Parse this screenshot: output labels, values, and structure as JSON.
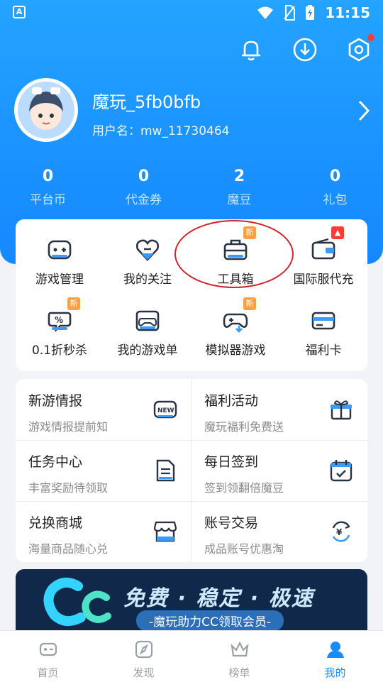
{
  "status": {
    "time": "11:15",
    "left_icon": "A"
  },
  "top_icons": [
    "bell-icon",
    "download-icon",
    "settings-icon"
  ],
  "profile": {
    "name": "魔玩_5fb0bfb",
    "user_label": "用户名：mw_11730464"
  },
  "stats": [
    {
      "value": "0",
      "label": "平台币"
    },
    {
      "value": "0",
      "label": "代金券"
    },
    {
      "value": "2",
      "label": "魔豆"
    },
    {
      "value": "0",
      "label": "礼包"
    }
  ],
  "grid": [
    {
      "label": "游戏管理",
      "icon": "gamepad-icon",
      "badge": ""
    },
    {
      "label": "我的关注",
      "icon": "heart-icon",
      "badge": ""
    },
    {
      "label": "工具箱",
      "icon": "toolbox-icon",
      "badge": "新"
    },
    {
      "label": "国际服代充",
      "icon": "wallet-icon",
      "badge": "hot"
    },
    {
      "label": "0.1折秒杀",
      "icon": "discount-icon",
      "badge": "新"
    },
    {
      "label": "我的游戏单",
      "icon": "controller-icon",
      "badge": ""
    },
    {
      "label": "模拟器游戏",
      "icon": "emulator-icon",
      "badge": "新"
    },
    {
      "label": "福利卡",
      "icon": "card-icon",
      "badge": ""
    }
  ],
  "menu": [
    {
      "title": "新游情报",
      "sub": "游戏情报提前知",
      "icon": "new-icon"
    },
    {
      "title": "福利活动",
      "sub": "魔玩福利免费送",
      "icon": "gift-icon"
    },
    {
      "title": "任务中心",
      "sub": "丰富奖励待领取",
      "icon": "task-icon"
    },
    {
      "title": "每日签到",
      "sub": "签到领翻倍魔豆",
      "icon": "calendar-icon"
    },
    {
      "title": "兑换商城",
      "sub": "海量商品随心兑",
      "icon": "store-icon"
    },
    {
      "title": "账号交易",
      "sub": "成品账号优惠淘",
      "icon": "trade-icon"
    }
  ],
  "banner": {
    "title": "免费 · 稳定 · 极速",
    "sub": "-魔玩助力CC领取会员-"
  },
  "tabs": [
    {
      "label": "首页",
      "icon": "home-icon",
      "active": false
    },
    {
      "label": "发现",
      "icon": "compass-icon",
      "active": false
    },
    {
      "label": "榜单",
      "icon": "crown-icon",
      "active": false
    },
    {
      "label": "我的",
      "icon": "user-icon",
      "active": true
    }
  ],
  "colors": {
    "primary": "#1a8cff",
    "accent_badge": "#ff9f43",
    "hot": "#ff3b30",
    "highlight_circle": "#d0242b"
  }
}
